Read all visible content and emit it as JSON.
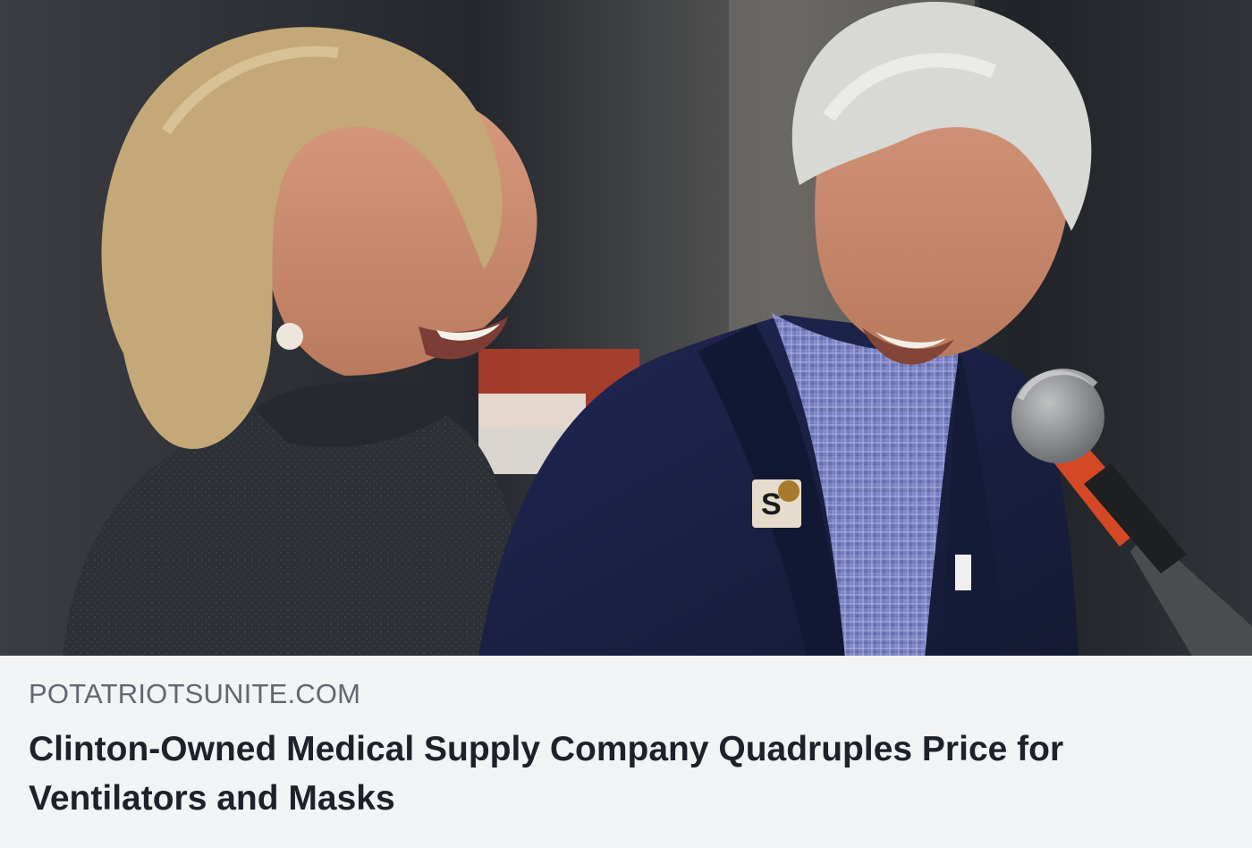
{
  "link_preview": {
    "image_alt": "",
    "domain": "POTATRIOTSUNITE.COM",
    "headline": "Clinton-Owned Medical Supply Company Quadruples Price for Ventilators and Masks"
  },
  "colors": {
    "card_background": "#f2f3f5",
    "domain_text": "#606770",
    "headline_text": "#1d2129",
    "photo_backdrop": "#2b2d33",
    "left_jacket": "#2f3236",
    "right_suit": "#1d2242",
    "right_shirt": "#6f78b8",
    "hair_light": "#d8d8d4",
    "hair_blonde": "#c5a878",
    "skin": "#d9a58a",
    "mic_red": "#d54826",
    "mic_grille": "#7d7f80"
  },
  "icons": {
    "image": "photo-icon"
  }
}
